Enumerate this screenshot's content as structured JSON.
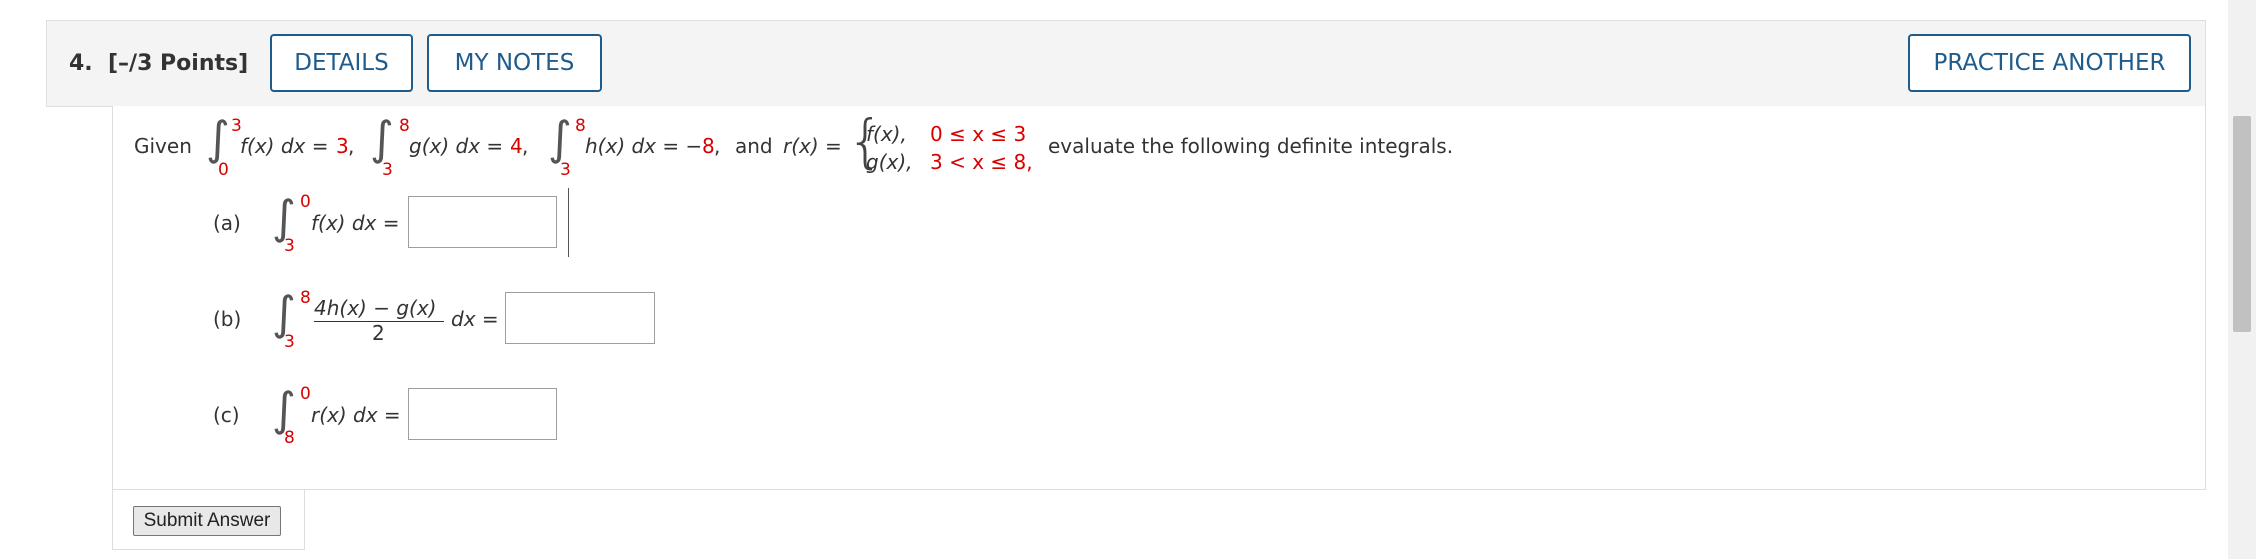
{
  "question": {
    "number": "4.",
    "points": "[–/3 Points]"
  },
  "buttons": {
    "details": "DETAILS",
    "my_notes": "MY NOTES",
    "practice_another": "PRACTICE ANOTHER",
    "submit": "Submit Answer"
  },
  "given": {
    "word": "Given",
    "int1": {
      "upper": "3",
      "lower": "0",
      "integrand": "f(x) dx =",
      "value": "3",
      "after": ","
    },
    "int2": {
      "upper": "8",
      "lower": "3",
      "integrand": "g(x) dx =",
      "value": "4",
      "after": ","
    },
    "int3": {
      "upper": "8",
      "lower": "3",
      "integrand": "h(x) dx = −",
      "value": "8",
      "after": ","
    },
    "and": "and",
    "r_def": "r(x) =",
    "case1": {
      "expr": "f(x),",
      "cond": "0 ≤ x ≤ 3"
    },
    "case2": {
      "expr": "g(x),",
      "cond": "3 < x ≤ 8,"
    },
    "instruction": "evaluate the following definite integrals."
  },
  "parts": [
    {
      "label": "(a)",
      "upper": "0",
      "lower": "3",
      "integrand": "f(x) dx =",
      "answer": ""
    },
    {
      "label": "(b)",
      "upper": "8",
      "lower": "3",
      "numerator": "4h(x) − g(x)",
      "denominator": "2",
      "after": "dx =",
      "answer": ""
    },
    {
      "label": "(c)",
      "upper": "0",
      "lower": "8",
      "integrand": "r(x) dx =",
      "answer": ""
    }
  ],
  "colors": {
    "accent": "#1f5b8b",
    "limits": "#d90000"
  }
}
